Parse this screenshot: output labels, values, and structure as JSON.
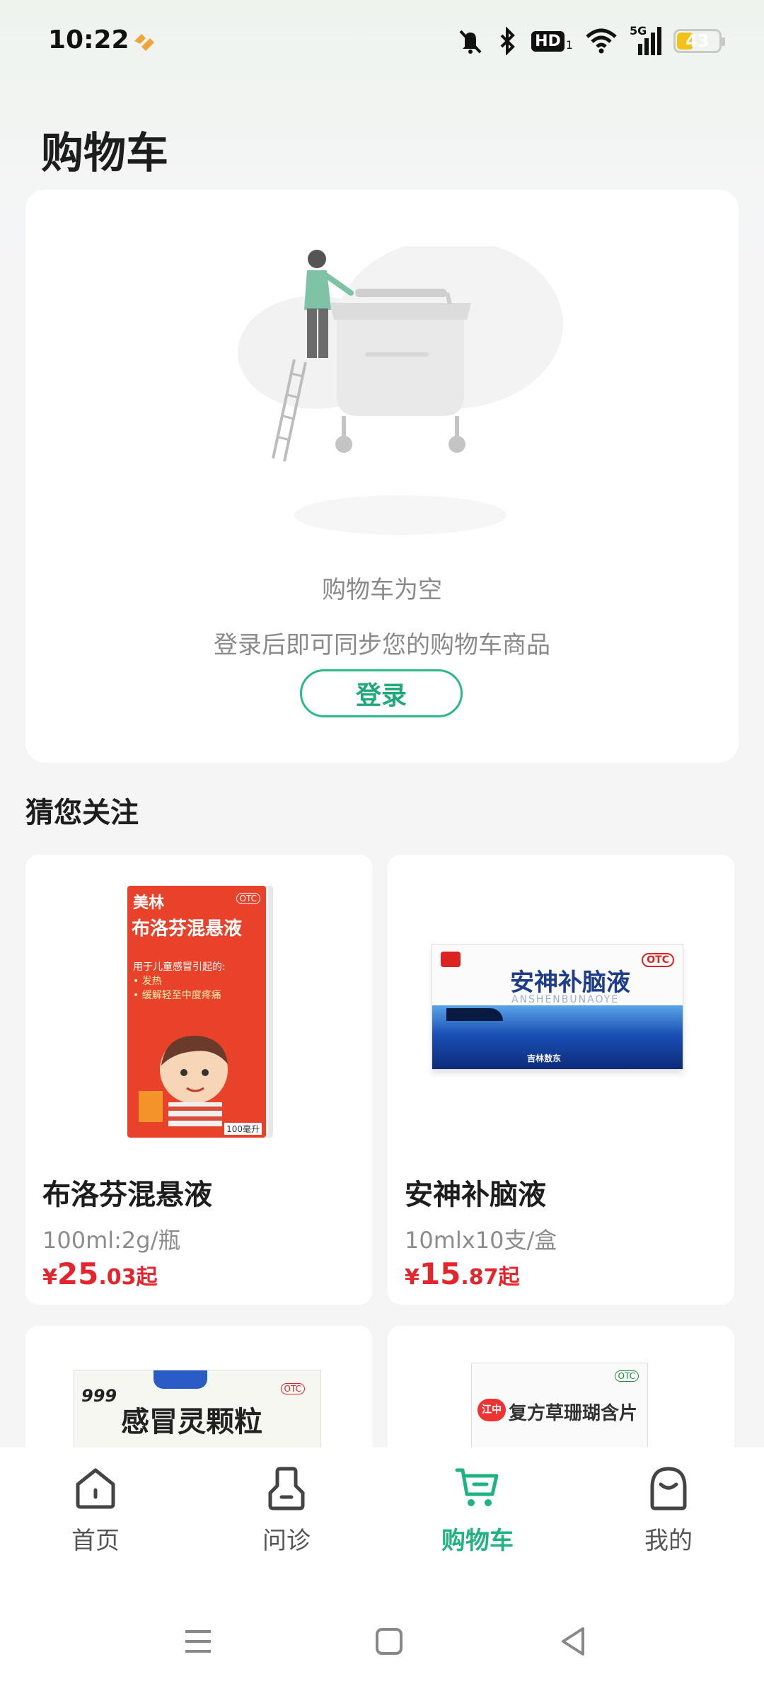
{
  "status_bar": {
    "time": "10:22",
    "hd_label": "HD",
    "sim_index": "1",
    "network": "5G",
    "battery": "43",
    "battery_level": 0.43,
    "icons": [
      "brand-icon",
      "mute-bell-icon",
      "bluetooth-icon",
      "hd-icon",
      "wifi-icon",
      "signal-icon",
      "battery-icon"
    ]
  },
  "header": {
    "title": "购物车"
  },
  "empty_cart": {
    "title": "购物车为空",
    "subtitle": "登录后即可同步您的购物车商品",
    "login_label": "登录"
  },
  "recommend": {
    "title": "猜您关注",
    "products": [
      {
        "name": "布洛芬混悬液",
        "spec": "100ml:2g/瓶",
        "price_symbol": "¥",
        "price_int": "25",
        "price_dec": ".03",
        "price_suffix": "起",
        "box_brand": "美林",
        "box_title": "布洛芬混悬液",
        "box_lines": [
          "用于儿童感冒引起的:",
          "• 发热",
          "• 缓解轻至中度疼痛"
        ],
        "box_volume": "100毫升",
        "otc": "OTC"
      },
      {
        "name": "安神补脑液",
        "spec": "10mlx10支/盒",
        "price_symbol": "¥",
        "price_int": "15",
        "price_dec": ".87",
        "price_suffix": "起",
        "box_title": "安神补脑液",
        "box_pinyin": "ANSHENBUNAOYE",
        "box_maker": "吉林敖东",
        "otc": "OTC"
      },
      {
        "box_brand": "999",
        "box_title": "感冒灵颗粒",
        "otc": "OTC"
      },
      {
        "box_brand": "江中",
        "box_title": "复方草珊瑚含片",
        "otc": "OTC"
      }
    ]
  },
  "bottom_nav": {
    "items": [
      {
        "label": "首页",
        "icon": "home-icon"
      },
      {
        "label": "问诊",
        "icon": "consult-icon"
      },
      {
        "label": "购物车",
        "icon": "cart-icon",
        "active": true
      },
      {
        "label": "我的",
        "icon": "profile-icon"
      }
    ]
  },
  "system_nav": {
    "icons": [
      "menu-icon",
      "home-square-icon",
      "back-icon"
    ]
  },
  "colors": {
    "accent": "#1fb37f",
    "price": "#e3262d",
    "background": "#f5f5f6"
  }
}
